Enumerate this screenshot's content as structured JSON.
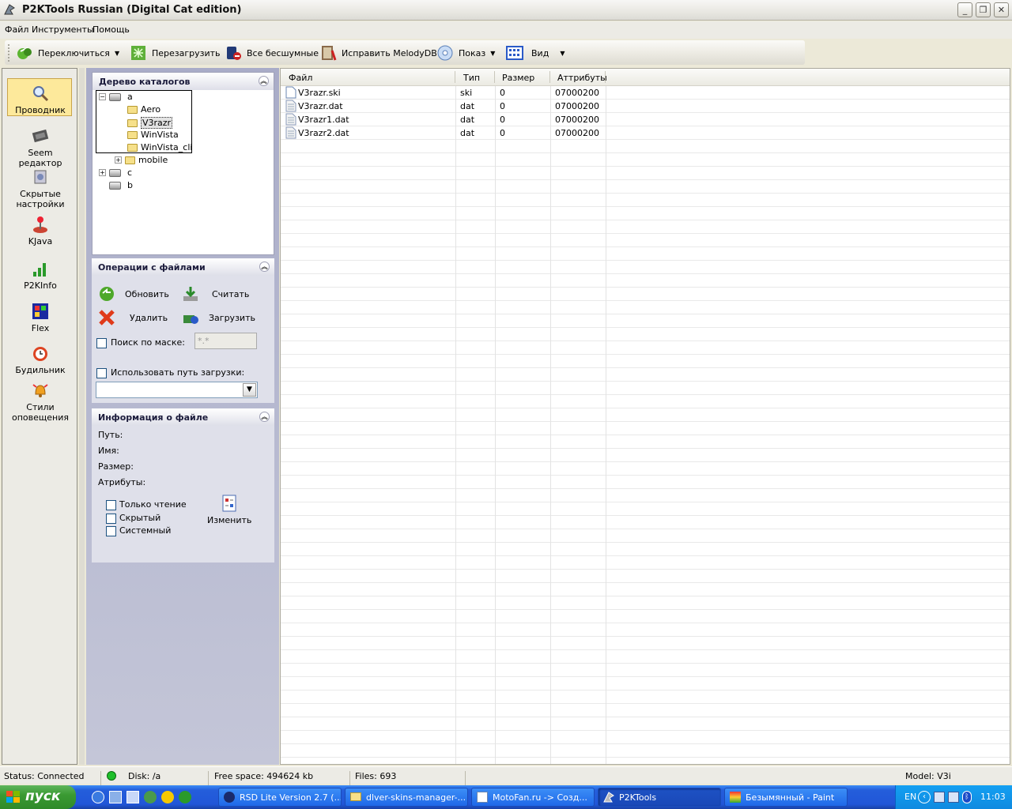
{
  "window": {
    "title": "P2KTools Russian (Digital Cat edition)"
  },
  "menu": [
    "Файл",
    "Инструменты",
    "Помощь"
  ],
  "toolbar": {
    "switch": "Переключиться",
    "reboot": "Перезагрузить",
    "all_silent": "Все бесшумные",
    "fix_melody": "Исправить MelodyDB",
    "show": "Показ",
    "view": "Вид"
  },
  "nav": [
    {
      "label": "Проводник",
      "selected": true
    },
    {
      "label": "Seem редактор"
    },
    {
      "label": "Скрытые настройки"
    },
    {
      "label": "KJava"
    },
    {
      "label": "P2KInfo"
    },
    {
      "label": "Flex"
    },
    {
      "label": "Будильник"
    },
    {
      "label": "Стили оповещения"
    }
  ],
  "tree_panel": {
    "title": "Дерево каталогов",
    "nodes": [
      "a",
      "Aero",
      "V3razr",
      "WinVista",
      "WinVista_cli",
      "mobile",
      "c",
      "b"
    ],
    "selected": "V3razr"
  },
  "file_ops": {
    "title": "Операции с файлами",
    "refresh": "Обновить",
    "read": "Считать",
    "delete": "Удалить",
    "upload": "Загрузить",
    "mask_label": "Поиск по маске:",
    "mask_value": "*.*",
    "use_path_label": "Использовать путь загрузки:"
  },
  "file_info": {
    "title": "Информация о файле",
    "path": "Путь:",
    "name": "Имя:",
    "size": "Размер:",
    "attrs": "Атрибуты:",
    "readonly": "Только чтение",
    "hidden": "Скрытый",
    "system": "Системный",
    "change": "Изменить"
  },
  "list": {
    "columns": [
      "Файл",
      "Тип",
      "Размер",
      "Аттрибуты"
    ],
    "rows": [
      {
        "name": "V3razr.ski",
        "type": "ski",
        "size": "0",
        "attr": "07000200"
      },
      {
        "name": "V3razr.dat",
        "type": "dat",
        "size": "0",
        "attr": "07000200"
      },
      {
        "name": "V3razr1.dat",
        "type": "dat",
        "size": "0",
        "attr": "07000200"
      },
      {
        "name": "V3razr2.dat",
        "type": "dat",
        "size": "0",
        "attr": "07000200"
      }
    ]
  },
  "status": {
    "connection": "Status: Connected",
    "disk": "Disk: /a",
    "free": "Free space: 494624 kb",
    "files": "Files: 693",
    "model": "Model: V3i",
    "indicator_color": "#1fbf2a"
  },
  "taskbar": {
    "start": "пуск",
    "tasks": [
      "RSD Lite Version 2.7 (...",
      "dlver-skins-manager-...",
      "MotoFan.ru -> Созд...",
      "P2KTools",
      "Безымянный - Paint"
    ],
    "lang": "EN",
    "clock": "11:03"
  }
}
